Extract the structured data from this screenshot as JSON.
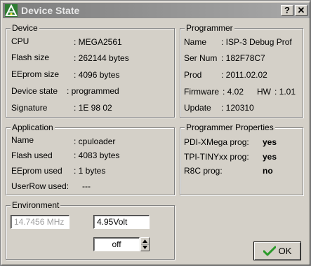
{
  "window": {
    "title": "Device State",
    "help_label": "?",
    "close_label": "✕"
  },
  "device": {
    "legend": "Device",
    "rows": [
      {
        "label": "CPU",
        "value": ": MEGA2561"
      },
      {
        "label": "Flash size",
        "value": ": 262144 bytes"
      },
      {
        "label": "EEprom size",
        "value": ": 4096 bytes"
      },
      {
        "label": "Device state",
        "value": ": programmed"
      },
      {
        "label": "Signature",
        "value": ": 1E 98 02"
      }
    ]
  },
  "programmer": {
    "legend": "Programmer",
    "rows": [
      {
        "label": "Name",
        "value": ": ISP-3 Debug Prof"
      },
      {
        "label": "Ser Num",
        "value": ": 182F78C7"
      },
      {
        "label": "Prod",
        "value": ": 2011.02.02"
      },
      {
        "label": "Firmware",
        "value": ": 4.02",
        "extra_label": "HW",
        "extra_value": ": 1.01"
      },
      {
        "label": "Update",
        "value": ": 120310"
      }
    ]
  },
  "application": {
    "legend": "Application",
    "rows": [
      {
        "label": "Name",
        "value": ": cpuloader"
      },
      {
        "label": "Flash used",
        "value": ": 4083 bytes"
      },
      {
        "label": "EEprom used",
        "value": ": 1 bytes"
      },
      {
        "label": "UserRow used:",
        "value": "---"
      }
    ]
  },
  "programmer_properties": {
    "legend": "Programmer Properties",
    "rows": [
      {
        "label": "PDI-XMega prog:",
        "value": "yes"
      },
      {
        "label": "TPI-TINYxx prog:",
        "value": "yes"
      },
      {
        "label": "R8C prog:",
        "value": "no"
      }
    ]
  },
  "environment": {
    "legend": "Environment",
    "frequency": "14.7456 MHz",
    "voltage": "4.95Volt",
    "spinner_value": "off"
  },
  "ok_button": {
    "label": "OK",
    "icon": "check-icon",
    "icon_color": "#2a9a2a"
  }
}
